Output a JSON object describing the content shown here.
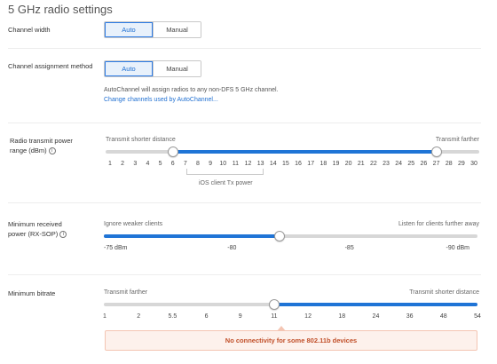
{
  "page": {
    "title": "5 GHz radio settings"
  },
  "channel_width": {
    "label": "Channel width",
    "options": [
      "Auto",
      "Manual"
    ],
    "selected": "Auto"
  },
  "channel_assignment": {
    "label": "Channel assignment method",
    "options": [
      "Auto",
      "Manual"
    ],
    "selected": "Auto",
    "description": "AutoChannel will assign radios to any non-DFS 5 GHz channel.",
    "link": "Change channels used by AutoChannel..."
  },
  "tx_power": {
    "label_line1": "Radio transmit power",
    "label_line2": "range (dBm)",
    "left_hint": "Transmit shorter distance",
    "right_hint": "Transmit farther",
    "ticks": [
      "1",
      "2",
      "3",
      "4",
      "5",
      "6",
      "7",
      "8",
      "9",
      "10",
      "11",
      "12",
      "13",
      "14",
      "15",
      "16",
      "17",
      "18",
      "19",
      "20",
      "21",
      "22",
      "23",
      "24",
      "25",
      "26",
      "27",
      "28",
      "29",
      "30"
    ],
    "range_low": 6,
    "range_high": 27,
    "ios_label": "iOS client Tx power",
    "ios_range": [
      8,
      14
    ]
  },
  "rx_sop": {
    "label_line1": "Minimum received",
    "label_line2": "power (RX-SOP)",
    "left_hint": "Ignore weaker clients",
    "right_hint": "Listen for clients further away",
    "ticks": [
      "-75 dBm",
      "-80",
      "-85",
      "-90 dBm"
    ],
    "value_fraction": 0.47
  },
  "min_bitrate": {
    "label": "Minimum bitrate",
    "left_hint": "Transmit farther",
    "right_hint": "Transmit shorter distance",
    "ticks": [
      "1",
      "2",
      "5.5",
      "6",
      "9",
      "11",
      "12",
      "18",
      "24",
      "36",
      "48",
      "54"
    ],
    "value": "11",
    "warning": "No connectivity for some 802.11b devices"
  },
  "icons": {
    "info": "info-icon"
  },
  "colors": {
    "accent": "#1f74d6",
    "warning_text": "#c1502a",
    "warning_bg": "#fdf1ec"
  }
}
